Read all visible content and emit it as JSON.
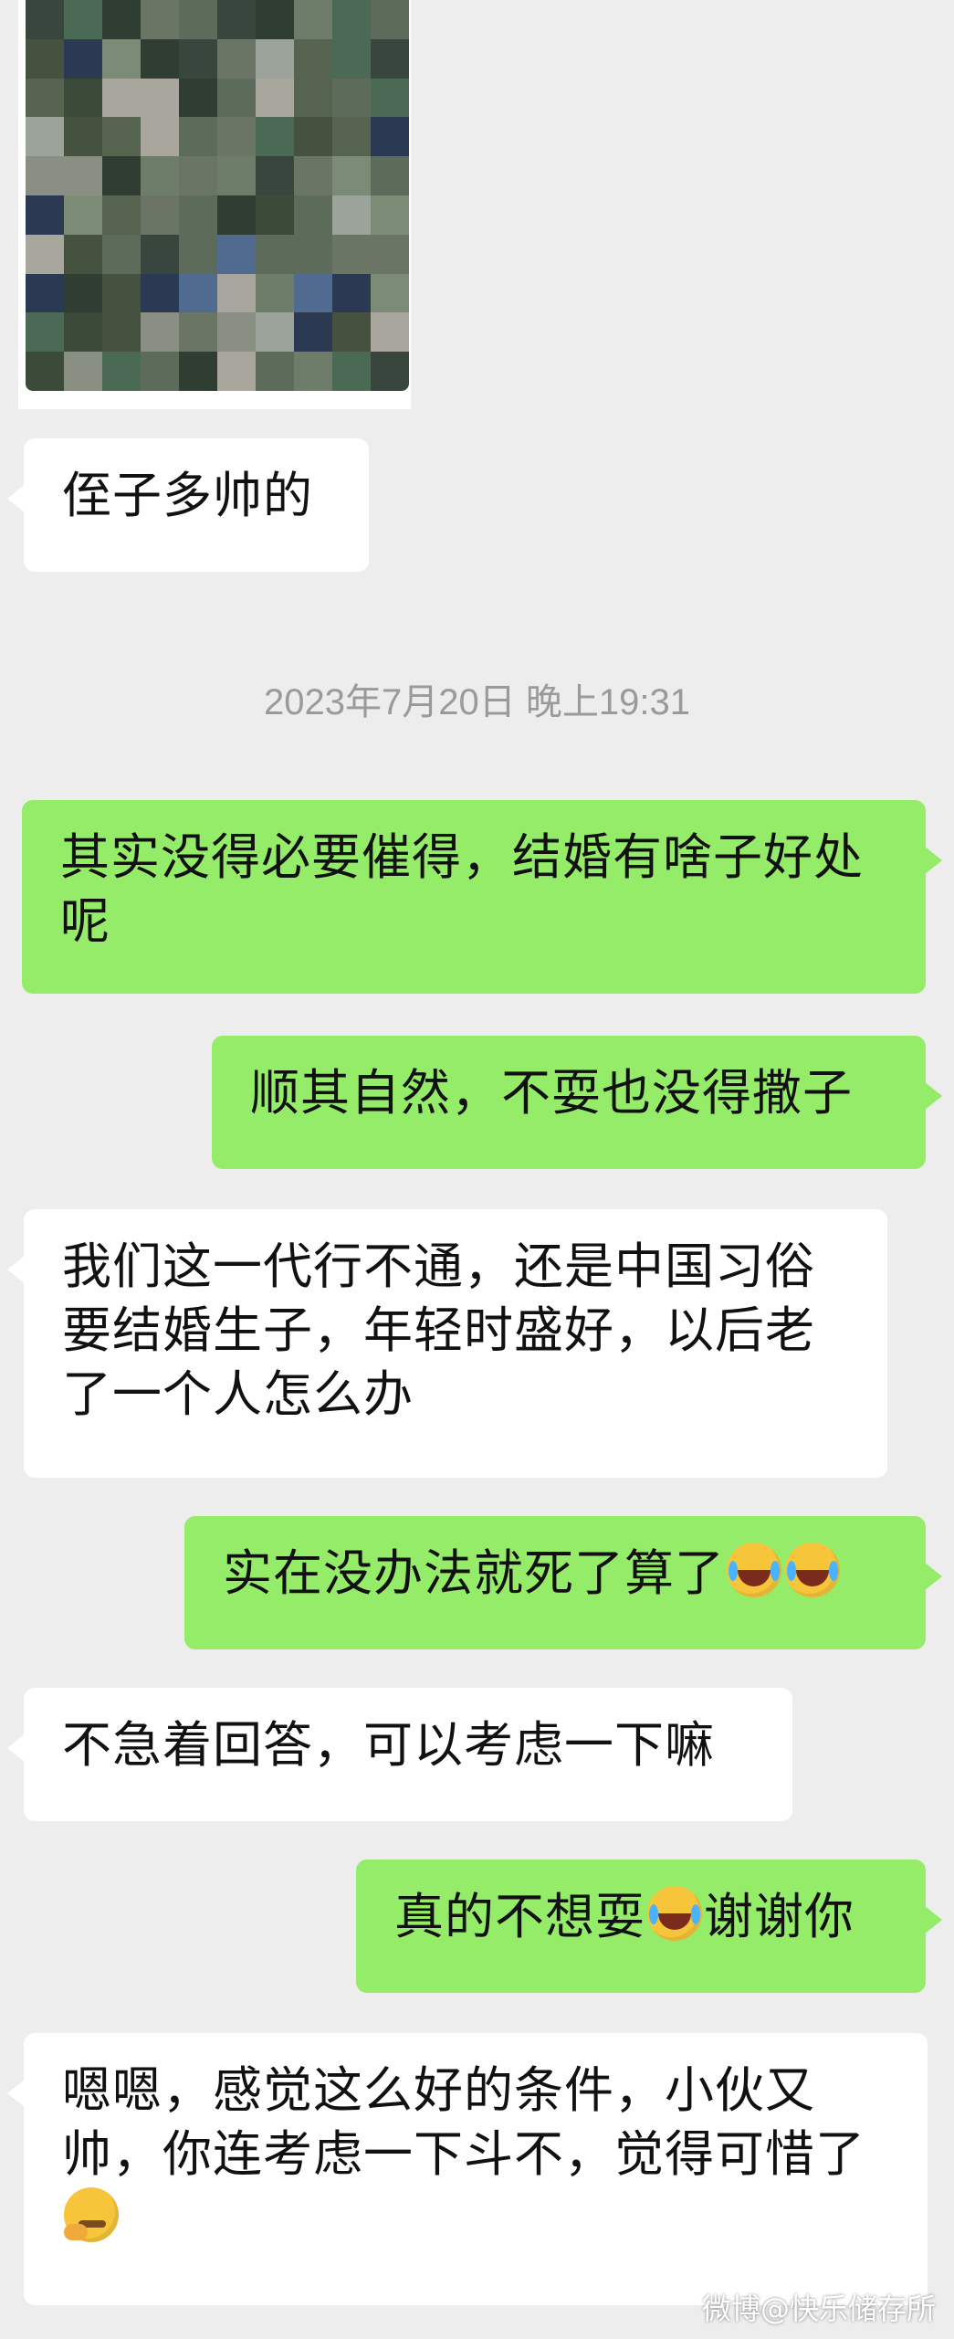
{
  "messages": {
    "m1": "侄子多帅的",
    "m2": "其实没得必要催得，结婚有啥子好处呢",
    "m3": "顺其自然，不耍也没得撒子",
    "m4": "我们这一代行不通，还是中国习俗要结婚生子，年轻时盛好，以后老了一个人怎么办",
    "m5": "实在没办法就死了算了",
    "m6": "不急着回答，可以考虑一下嘛",
    "m7a": "真的不想耍",
    "m7b": "谢谢你",
    "m8": "嗯嗯，感觉这么好的条件，小伙又帅，你连考虑一下斗不，觉得可惜了"
  },
  "timestamp": "2023年7月20日 晚上19:31",
  "watermark": "微博@快乐储存所",
  "colors": {
    "background": "#ededed",
    "incoming": "#ffffff",
    "outgoing": "#95ec69"
  },
  "icons": [
    "laughing-tears-emoji",
    "thinking-emoji"
  ]
}
